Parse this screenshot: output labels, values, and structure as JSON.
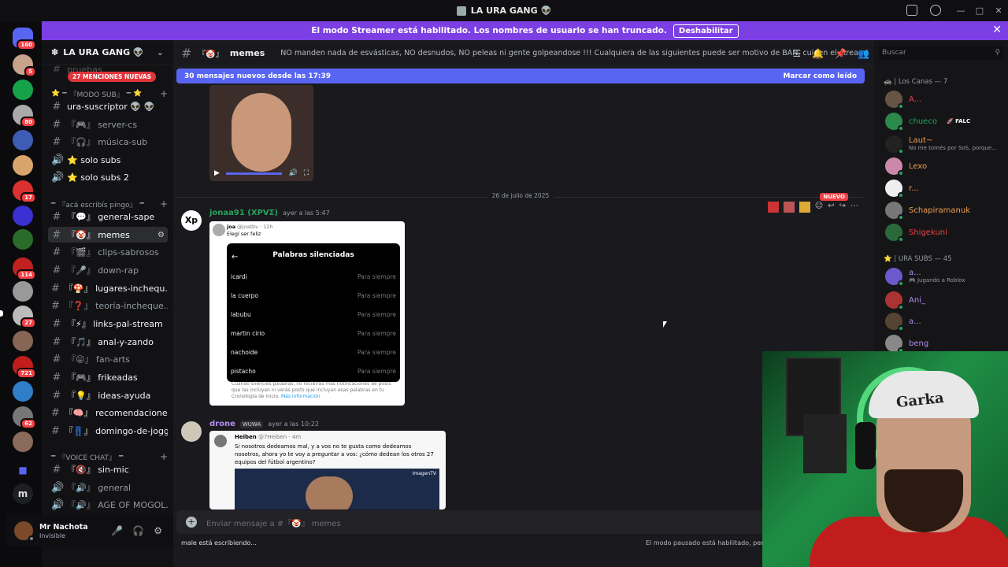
{
  "window": {
    "title": "LA URA GANG 👽"
  },
  "banner": {
    "text": "El modo Streamer está habilitado. Los nombres de usuario se han truncado.",
    "button": "Deshabilitar"
  },
  "rail": {
    "badges": [
      "160",
      "5",
      "80",
      "17",
      "114",
      "27",
      "721",
      "62"
    ],
    "letter": "m"
  },
  "server": {
    "name": "LA URA GANG 👽",
    "mentions": "27 MENCIONES NUEVAS",
    "top_channel": "pruebas",
    "categories": [
      "『MODO SUB』",
      "『acá escribís pingo』",
      "『VOICE CHAT』"
    ],
    "channels_sub": [
      {
        "icon": "#",
        "label": "ura-suscriptor 👽 👽"
      },
      {
        "icon": "#",
        "label": "『🎮』 server-cs"
      },
      {
        "icon": "#",
        "label": "『🎧』 música-sub"
      },
      {
        "icon": "🔊",
        "label": "⭐ solo subs"
      },
      {
        "icon": "🔊",
        "label": "⭐ solo subs 2"
      }
    ],
    "channels_main": [
      {
        "icon": "#",
        "label": "『💬』 general-sape"
      },
      {
        "icon": "#",
        "label": "『🤡』 memes"
      },
      {
        "icon": "#",
        "label": "『🎬』 clips-sabrosos"
      },
      {
        "icon": "#",
        "label": "『🎤』 down-rap"
      },
      {
        "icon": "#",
        "label": "『🍄』 lugares-inchequ..."
      },
      {
        "icon": "#",
        "label": "『❓』 teoría-incheque..."
      },
      {
        "icon": "#",
        "label": "『⚡』 links-pal-stream"
      },
      {
        "icon": "#",
        "label": "『🎵』 anal-y-zando"
      },
      {
        "icon": "#",
        "label": "『😛』 fan-arts"
      },
      {
        "icon": "#",
        "label": "『🎮』 frikeadas"
      },
      {
        "icon": "#",
        "label": "『💡』 ideas-ayuda"
      },
      {
        "icon": "#",
        "label": "『🧠』 recomendaciones"
      },
      {
        "icon": "#",
        "label": "『👖』 domingo-de-joggin"
      }
    ],
    "channels_voice": [
      {
        "icon": "#",
        "label": "『🔇』 sin-mic"
      },
      {
        "icon": "🔊",
        "label": "『🔊』 general"
      },
      {
        "icon": "🔊",
        "label": "『🔊』 AGE OF MOGOL..."
      }
    ]
  },
  "user": {
    "name": "Mr Nachota",
    "status": "Invisible"
  },
  "channel": {
    "name": "memes",
    "prefix": "『🤡』",
    "topic": "NO manden nada de esvásticas, NO desnudos, NO peleas ni gente golpeandose !!! Cualquiera de las siguientes puede ser motivo de BAN, cuiden el stream!",
    "new_messages": "30 mensajes nuevos desde las 17:39",
    "mark_read": "Marcar como leído",
    "date_divider": "26 de julio de 2025",
    "nuevo": "NUEVO"
  },
  "messages": [
    {
      "author": "jonaa91 (ΧΡVΣ)",
      "time": "ayer a las 5:47",
      "tweet": {
        "user": "joa",
        "handle": "@joatbv · 12h",
        "text": "Elegí ser feliz",
        "screen_title": "Palabras silenciadas",
        "screen_handle": "@joatbv",
        "rows": [
          "icardi",
          "la cuerpo",
          "labubu",
          "martin cirio",
          "nachoide",
          "pistacho"
        ],
        "row_value": "Para siempre",
        "note": "Cuando silencies palabras, no recibirás más notificaciones de posts que las incluyan ni verás posts que incluyan esas palabras en tu Cronología de inicio.",
        "more": "Más información"
      }
    },
    {
      "author": "drone",
      "tag": "WUWA",
      "time": "ayer a las 10:22",
      "tweet": {
        "user": "Heiben",
        "handle": "@7Heiben · 4m",
        "text": "Si nosotros dedeamos mal, y a vos no te gusta como dedeamos nosotros, ahora yo te voy a preguntar a vos: ¿cómo dedean los otros 27 equipos del fútbol argentino?",
        "media_label": "ImagenTV"
      }
    }
  ],
  "composer": {
    "placeholder": "Enviar mensaje a #『🤡』 memes"
  },
  "typing": "male está escribiendo...",
  "paused": "El modo pausado está habilitado, per",
  "search": {
    "placeholder": "Buscar"
  },
  "members": {
    "groups": [
      {
        "title": "🚓 | Los Canas — 7",
        "items": [
          {
            "name": "A...",
            "color": "#f23f43"
          },
          {
            "name": "chueco",
            "badge": "🚀 FALC",
            "color": "#23a55a"
          },
          {
            "name": "Laut~",
            "sub": "No me tomés por SoS, porque...",
            "color": "#f0a04b"
          },
          {
            "name": "Lexo",
            "color": "#f0a04b"
          },
          {
            "name": "r...",
            "color": "#f0a04b"
          },
          {
            "name": "Schapiramanuk",
            "color": "#f0a04b"
          },
          {
            "name": "Shigekuni",
            "color": "#f23f43"
          }
        ]
      },
      {
        "title": "⭐ | URA SUBS — 45",
        "items": [
          {
            "name": "a...",
            "sub": "🎮 Jugando a Roblox",
            "color": "#b48cf2"
          },
          {
            "name": "Ani_",
            "color": "#b48cf2"
          },
          {
            "name": "a...",
            "color": "#b48cf2"
          },
          {
            "name": "beng",
            "color": "#b48cf2"
          }
        ]
      }
    ]
  },
  "webcam": {
    "caption": "Garka"
  },
  "colors": {
    "blurple": "#5865f2",
    "streamer_banner": "#7b3fe4",
    "danger": "#f23f43"
  }
}
